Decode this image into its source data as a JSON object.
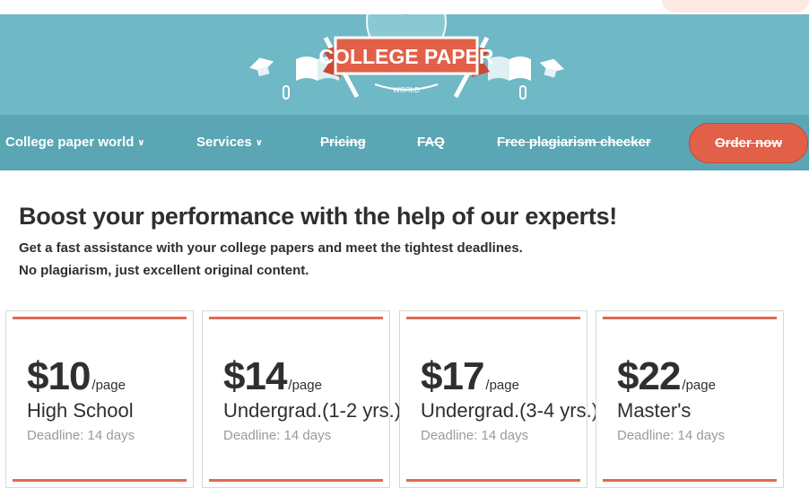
{
  "logo": {
    "name": "COLLEGE PAPER",
    "tagline": "WORLD"
  },
  "nav": {
    "items": [
      {
        "label": "College paper world",
        "has_dropdown": true
      },
      {
        "label": "Services",
        "has_dropdown": true
      },
      {
        "label": "Pricing",
        "has_dropdown": false
      },
      {
        "label": "FAQ",
        "has_dropdown": false
      },
      {
        "label": "Free plagiarism checker",
        "has_dropdown": false
      }
    ],
    "order_label": "Order now"
  },
  "hero": {
    "headline": "Boost your performance with the help of our experts!",
    "line1": "Get a fast assistance with your college papers and meet the tightest deadlines.",
    "line2": "No plagiarism, just excellent original content."
  },
  "pricing": [
    {
      "amount": "$10",
      "unit": "/page",
      "level": "High School",
      "deadline": "Deadline: 14 days"
    },
    {
      "amount": "$14",
      "unit": "/page",
      "level": "Undergrad.(1-2 yrs.)",
      "deadline": "Deadline: 14 days"
    },
    {
      "amount": "$17",
      "unit": "/page",
      "level": "Undergrad.(3-4 yrs.)",
      "deadline": "Deadline: 14 days"
    },
    {
      "amount": "$22",
      "unit": "/page",
      "level": "Master's",
      "deadline": "Deadline: 14 days"
    }
  ],
  "colors": {
    "banner": "#6fb8c5",
    "nav": "#5aa6b4",
    "accent": "#e25f48"
  },
  "icons": [
    "graduation-cap-icon",
    "book-icon",
    "pencil-icon",
    "paperclip-icon",
    "globe-icon",
    "chevron-down-icon"
  ]
}
